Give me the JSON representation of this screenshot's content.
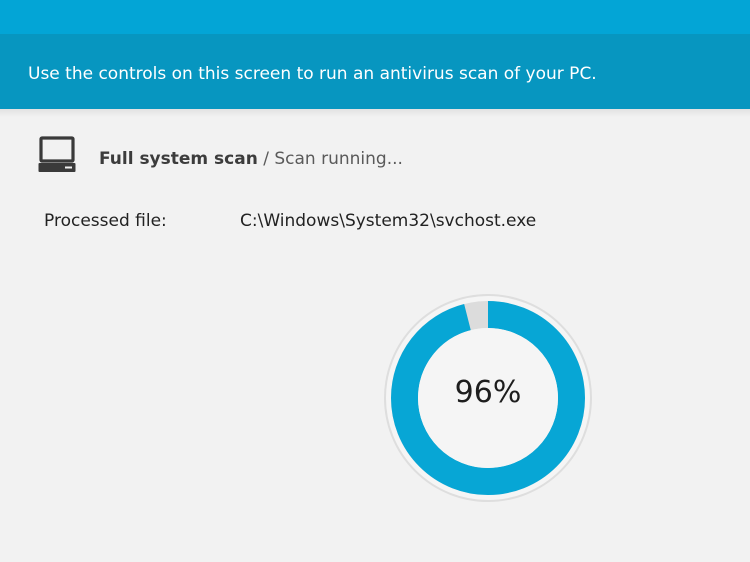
{
  "banner": {
    "text": "Use the controls on this screen to run an antivirus scan of your PC."
  },
  "scan": {
    "icon": "computer-icon",
    "type": "Full system scan",
    "separator": " / ",
    "status": "Scan running..."
  },
  "processed": {
    "label": "Processed file:",
    "value": "C:\\Windows\\System32\\svchost.exe"
  },
  "progress": {
    "percent": 96,
    "label": "96%"
  },
  "colors": {
    "top_strip": "#03a5d6",
    "banner": "#0796c0",
    "ring": "#07a6d5",
    "background": "#f2f2f2"
  }
}
